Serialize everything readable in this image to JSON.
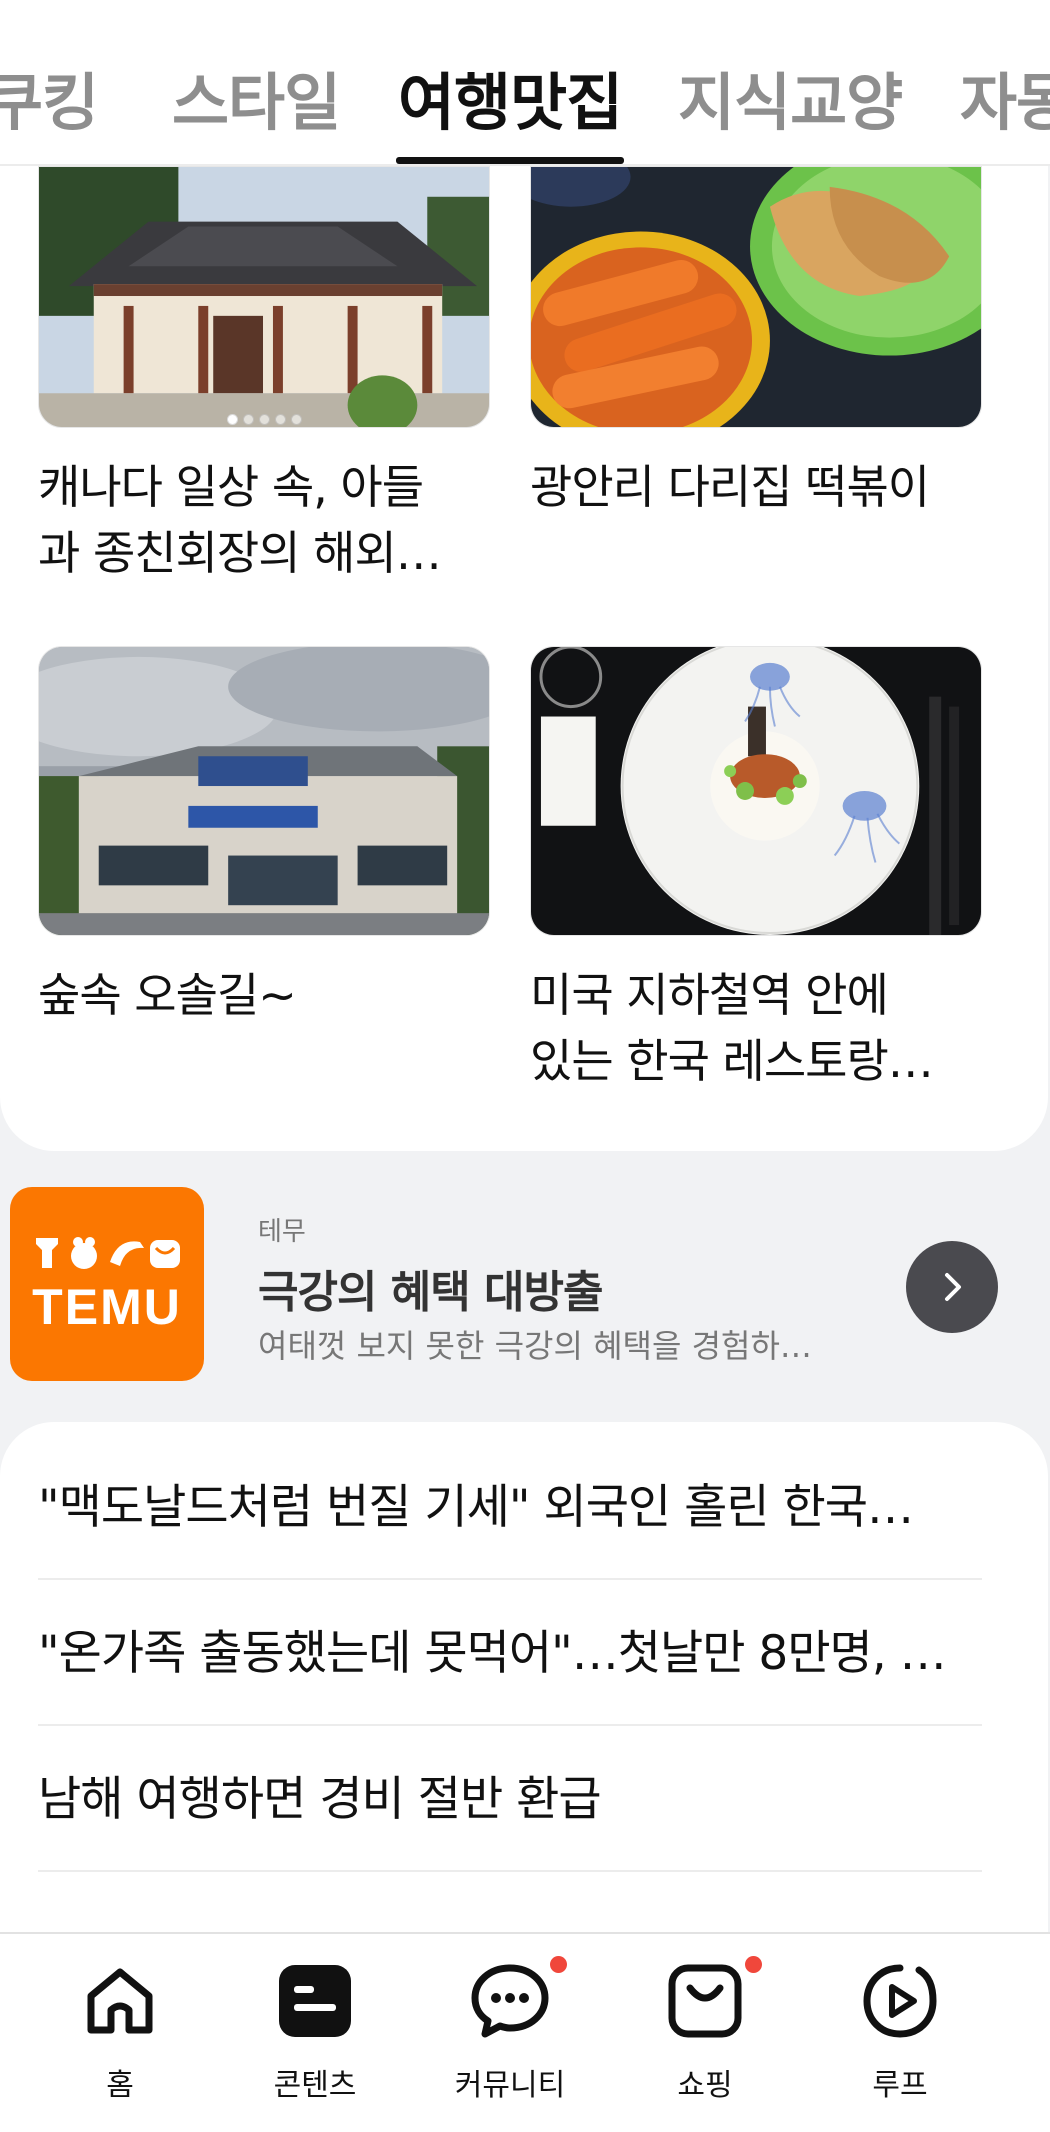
{
  "tabs": [
    {
      "label": "쿠킹",
      "active": false
    },
    {
      "label": "스타일",
      "active": false
    },
    {
      "label": "여행맛집",
      "active": true
    },
    {
      "label": "지식교양",
      "active": false
    },
    {
      "label": "자동차",
      "active": false
    }
  ],
  "cards": [
    {
      "title": "캐나다 일상 속, 아들\n과 종친회장의 해외…",
      "image": "hanok-house",
      "carousel_pages": 5,
      "carousel_active": 1
    },
    {
      "title": "광안리 다리집 떡볶이",
      "image": "tteokbokki-plate"
    },
    {
      "title": "숲속 오솔길~",
      "image": "station-building"
    },
    {
      "title": "미국 지하철역 안에\n있는 한국 레스토랑…",
      "image": "fine-dining-plate"
    }
  ],
  "ad": {
    "brand": "TEMU",
    "sponsor": "테무",
    "title": "극강의 혜택 대방출",
    "description": "여태껏 보지 못한 극강의 혜택을 경험하…",
    "accent": "#fb7701"
  },
  "news": [
    {
      "title": "\"맥도날드처럼 번질 기세\" 외국인 홀린 한국…"
    },
    {
      "title": "\"온가족 출동했는데 못먹어\"…첫날만 8만명, …"
    },
    {
      "title": "남해 여행하면 경비 절반 환급"
    }
  ],
  "bottom_nav": [
    {
      "label": "홈",
      "icon": "home-icon",
      "badge": false
    },
    {
      "label": "콘텐츠",
      "icon": "contents-icon",
      "badge": false
    },
    {
      "label": "커뮤니티",
      "icon": "chat-bubble-icon",
      "badge": true
    },
    {
      "label": "쇼핑",
      "icon": "shopping-bag-icon",
      "badge": true
    },
    {
      "label": "루프",
      "icon": "play-loop-icon",
      "badge": false
    }
  ],
  "colors": {
    "badge": "#f0473b",
    "active_tab": "#111111",
    "inactive_tab": "#8e8e8e"
  }
}
